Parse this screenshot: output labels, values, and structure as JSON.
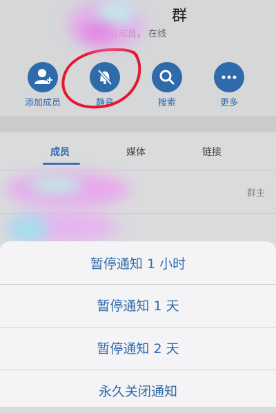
{
  "header": {
    "title": "群",
    "subtitle": "立成员，  在线"
  },
  "actions": [
    {
      "label": "添加成员",
      "icon": "add-member-icon"
    },
    {
      "label": "静音",
      "icon": "mute-bell-icon"
    },
    {
      "label": "搜索",
      "icon": "search-icon"
    },
    {
      "label": "更多",
      "icon": "more-icon"
    }
  ],
  "tabs": [
    {
      "label": "成员"
    },
    {
      "label": "媒体"
    },
    {
      "label": "链接"
    }
  ],
  "members": [
    {
      "role": "群主"
    }
  ],
  "sheet": {
    "options": [
      "暂停通知 1 小时",
      "暂停通知 1 天",
      "暂停通知 2 天",
      "永久关闭通知"
    ]
  },
  "colors": {
    "accent": "#2f6aaa",
    "annotation": "#e5162e"
  }
}
